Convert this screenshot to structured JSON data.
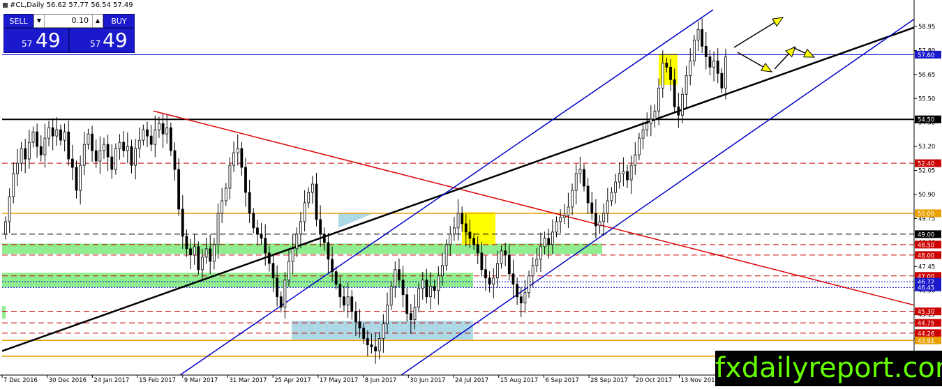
{
  "header": {
    "title": "#CL,Daily  56.62 57.77 56.54 57.49",
    "icon": "chart-icon"
  },
  "trade_panel": {
    "sell_label": "SELL",
    "buy_label": "BUY",
    "lot_value": "0.10",
    "sell_price_small": "57",
    "sell_price_big": "49",
    "buy_price_small": "57",
    "buy_price_big": "49"
  },
  "watermark": "fxdailyreport.com",
  "colors": {
    "channel": "#0000c8",
    "trendline_black": "#000000",
    "trendline_red": "#dd0000",
    "dashed_red": "#cc0000",
    "orange_level": "#e8a000",
    "green_zone": "#90ee90",
    "blue_zone": "#add8e6",
    "yellow_highlight": "#ffff00",
    "arrow_yellow": "#ffff00",
    "watermark_text": "#66ff00"
  },
  "chart_data": {
    "type": "candlestick",
    "symbol": "#CL",
    "timeframe": "Daily",
    "ohlc_last": {
      "open": 56.62,
      "high": 57.77,
      "low": 56.54,
      "close": 57.49
    },
    "ylim": [
      42.8,
      60.0
    ],
    "x_tick_labels": [
      "7 Dec 2016",
      "30 Dec 2016",
      "24 Jan 2017",
      "15 Feb 2017",
      "9 Mar 2017",
      "31 Mar 2017",
      "25 Apr 2017",
      "17 May 2017",
      "8 Jun 2017",
      "30 Jun 2017",
      "24 Jul 2017",
      "15 Aug 2017",
      "6 Sep 2017",
      "28 Sep 2017",
      "20 Oct 2017",
      "13 Nov 2017"
    ],
    "y_tick_labels": [
      "58.95",
      "57.80",
      "56.65",
      "55.50",
      "54.35",
      "53.20",
      "52.05",
      "50.90",
      "49.75",
      "48.60",
      "47.45",
      "46.30",
      "45.15",
      "44.00",
      "42.85"
    ],
    "closes": [
      49.6,
      50.8,
      51.9,
      52.4,
      53.1,
      52.6,
      53.4,
      53.9,
      53.2,
      52.8,
      53.6,
      54.1,
      53.7,
      54.0,
      53.5,
      53.9,
      52.6,
      52.2,
      51.1,
      52.3,
      53.3,
      53.8,
      53.0,
      52.5,
      53.0,
      53.3,
      52.7,
      52.1,
      53.1,
      53.4,
      53.0,
      53.2,
      52.3,
      53.1,
      53.5,
      54.0,
      53.7,
      53.3,
      54.0,
      54.3,
      53.8,
      54.1,
      53.0,
      52.1,
      50.2,
      48.9,
      48.3,
      48.0,
      48.4,
      47.3,
      47.9,
      48.3,
      47.7,
      48.5,
      50.0,
      50.6,
      51.2,
      52.3,
      52.9,
      53.1,
      52.2,
      51.0,
      50.0,
      49.3,
      49.0,
      48.8,
      48.1,
      47.6,
      46.9,
      46.0,
      45.5,
      46.8,
      47.7,
      48.3,
      49.0,
      49.6,
      50.5,
      51.0,
      51.4,
      49.7,
      49.0,
      48.6,
      47.8,
      47.2,
      46.6,
      46.0,
      45.6,
      46.0,
      45.3,
      44.8,
      44.5,
      44.0,
      43.7,
      43.6,
      43.4,
      44.0,
      44.7,
      45.6,
      46.5,
      47.3,
      46.8,
      46.1,
      45.2,
      44.9,
      45.5,
      46.4,
      46.8,
      46.0,
      46.5,
      46.3,
      47.0,
      47.5,
      48.5,
      49.0,
      49.3,
      50.0,
      49.5,
      49.1,
      48.8,
      48.5,
      48.1,
      47.3,
      46.9,
      46.6,
      46.9,
      47.6,
      48.2,
      48.0,
      47.1,
      46.6,
      46.0,
      45.7,
      46.2,
      47.0,
      47.5,
      47.8,
      48.4,
      48.8,
      48.5,
      49.1,
      49.6,
      49.8,
      49.9,
      50.3,
      51.1,
      51.9,
      52.1,
      51.3,
      50.5,
      50.0,
      49.4,
      49.6,
      50.0,
      50.6,
      51.0,
      51.5,
      51.9,
      52.0,
      51.6,
      52.3,
      52.8,
      53.6,
      54.0,
      54.3,
      54.5,
      54.9,
      56.0,
      57.2,
      57.0,
      56.4,
      55.1,
      54.7,
      55.7,
      56.6,
      57.3,
      58.3,
      58.8,
      58.0,
      57.5,
      57.0,
      57.3,
      56.7,
      56.0,
      57.49
    ]
  },
  "price_labels": [
    {
      "text": "57.60",
      "style": "blue-box",
      "price": 57.6
    },
    {
      "text": "54.50",
      "style": "black-box",
      "price": 54.5
    },
    {
      "text": "52.40",
      "style": "red-box",
      "price": 52.4
    },
    {
      "text": "50.00",
      "style": "orange-box",
      "price": 50.0
    },
    {
      "text": "49.00",
      "style": "black-box",
      "price": 49.0
    },
    {
      "text": "48.50",
      "style": "red-box",
      "price": 48.5
    },
    {
      "text": "48.00",
      "style": "red-box",
      "price": 48.0
    },
    {
      "text": "47.00",
      "style": "red-box",
      "price": 47.0
    },
    {
      "text": "46.72",
      "style": "blue-box",
      "price": 46.72
    },
    {
      "text": "46.45",
      "style": "blue-box",
      "price": 46.45
    },
    {
      "text": "45.30",
      "style": "red-box",
      "price": 45.3
    },
    {
      "text": "44.75",
      "style": "red-box",
      "price": 44.75
    },
    {
      "text": "44.26",
      "style": "red-box",
      "price": 44.26
    },
    {
      "text": "43.91",
      "style": "orange-box",
      "price": 43.91
    },
    {
      "text": "43.15",
      "style": "orange-box",
      "price": 43.15
    }
  ],
  "horizontal_levels": [
    {
      "price": 57.6,
      "style": "solid-blue"
    },
    {
      "price": 54.5,
      "style": "solid-black-thick"
    },
    {
      "price": 52.4,
      "style": "dashed-red"
    },
    {
      "price": 50.0,
      "style": "solid-orange"
    },
    {
      "price": 49.0,
      "style": "dashed-black"
    },
    {
      "price": 48.5,
      "style": "dashed-red"
    },
    {
      "price": 48.0,
      "style": "dashed-red"
    },
    {
      "price": 47.0,
      "style": "dashed-red"
    },
    {
      "price": 46.72,
      "style": "dotted-blue"
    },
    {
      "price": 46.45,
      "style": "dotted-blue"
    },
    {
      "price": 45.3,
      "style": "dashed-red"
    },
    {
      "price": 44.75,
      "style": "dashed-red"
    },
    {
      "price": 44.26,
      "style": "dashed-red"
    },
    {
      "price": 43.91,
      "style": "solid-orange"
    },
    {
      "price": 43.15,
      "style": "solid-orange"
    }
  ]
}
